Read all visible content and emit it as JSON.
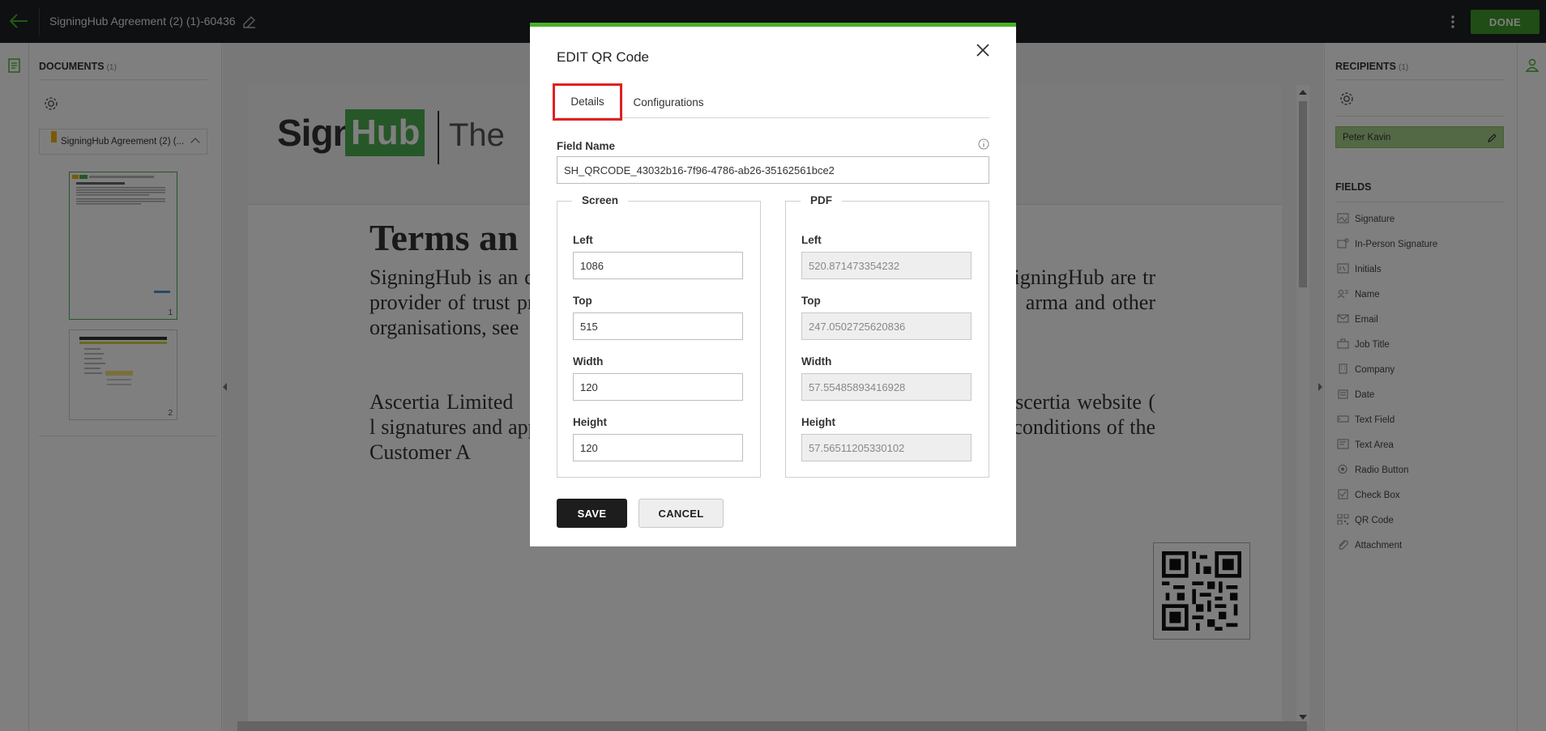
{
  "app": {
    "document_title": "SigningHub Agreement (2) (1)-60436",
    "done_label": "DONE"
  },
  "left_panel": {
    "title": "DOCUMENTS",
    "count": "(1)",
    "doc_chip": "SigningHub Agreement (2) (...",
    "pages": [
      "1",
      "2"
    ]
  },
  "document_view": {
    "logo_mark_text": "Signing",
    "logo_box_text": "Hub",
    "logo_tagline": "The",
    "heading": "Terms an",
    "paragraph1": "SigningHub is an c                                                   SigningHub and SigningHub are tr                                                   provider of trust products and solu                                                   arma and other organisations, see",
    "paragraph2": "Ascertia Limited                                                   escribed on the Ascertia website (                                                   l signatures and approval workflow                                                   is and conditions of the Customer A"
  },
  "right_panel": {
    "recipients_title": "RECIPIENTS",
    "recipients_count": "(1)",
    "recipient_name": "Peter Kavin",
    "fields_title": "FIELDS",
    "fields": [
      {
        "label": "Signature",
        "icon": "signature-icon"
      },
      {
        "label": "In-Person Signature",
        "icon": "in-person-signature-icon"
      },
      {
        "label": "Initials",
        "icon": "initials-icon"
      },
      {
        "label": "Name",
        "icon": "name-icon"
      },
      {
        "label": "Email",
        "icon": "email-icon"
      },
      {
        "label": "Job Title",
        "icon": "job-title-icon"
      },
      {
        "label": "Company",
        "icon": "company-icon"
      },
      {
        "label": "Date",
        "icon": "date-icon"
      },
      {
        "label": "Text Field",
        "icon": "text-field-icon"
      },
      {
        "label": "Text Area",
        "icon": "text-area-icon"
      },
      {
        "label": "Radio Button",
        "icon": "radio-button-icon"
      },
      {
        "label": "Check Box",
        "icon": "check-box-icon"
      },
      {
        "label": "QR Code",
        "icon": "qr-code-icon"
      },
      {
        "label": "Attachment",
        "icon": "attachment-icon"
      }
    ]
  },
  "modal": {
    "title": "EDIT QR Code",
    "tabs": [
      "Details",
      "Configurations"
    ],
    "field_name_label": "Field Name",
    "field_name_value": "SH_QRCODE_43032b16-7f96-4786-ab26-35162561bce2",
    "screen": {
      "legend": "Screen",
      "left_label": "Left",
      "left_value": "1086",
      "top_label": "Top",
      "top_value": "515",
      "width_label": "Width",
      "width_value": "120",
      "height_label": "Height",
      "height_value": "120"
    },
    "pdf": {
      "legend": "PDF",
      "left_label": "Left",
      "left_value": "520.871473354232",
      "top_label": "Top",
      "top_value": "247.0502725620836",
      "width_label": "Width",
      "width_value": "57.55485893416928",
      "height_label": "Height",
      "height_value": "57.56511205330102"
    },
    "save_label": "SAVE",
    "cancel_label": "CANCEL"
  },
  "colors": {
    "accent_green": "#47b229",
    "done_green": "#3f9b2a",
    "highlight_red": "#e02020",
    "topbar": "#1c2125",
    "recipient_bg": "#a6d08a"
  }
}
